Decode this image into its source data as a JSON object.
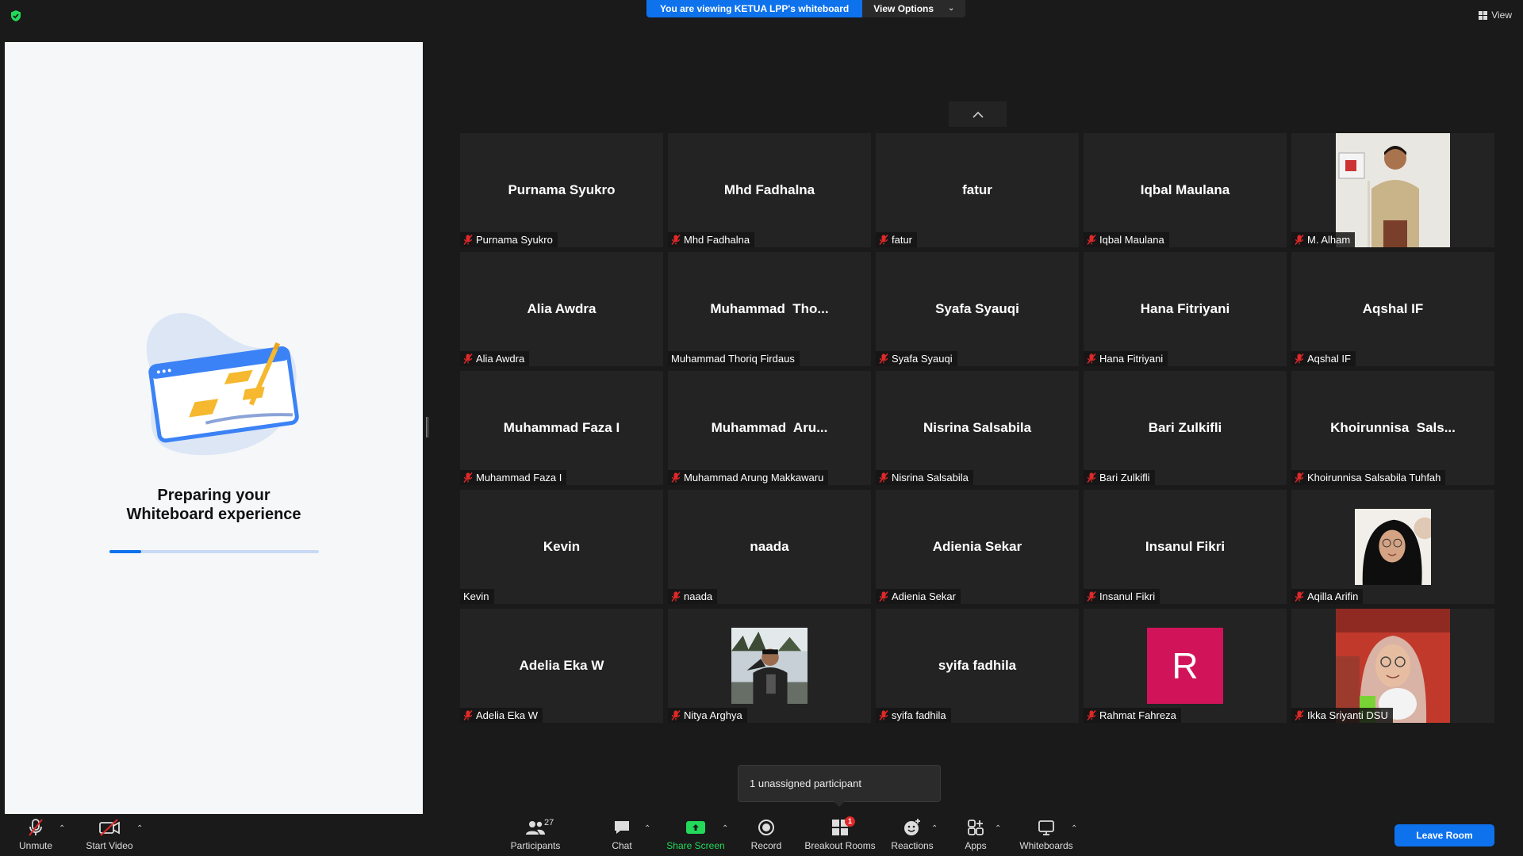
{
  "banner": {
    "viewing": "You are viewing KETUA LPP's whiteboard",
    "view_options": "View Options"
  },
  "view_button": "View",
  "whiteboard": {
    "title_line1": "Preparing your",
    "title_line2": "Whiteboard experience",
    "progress": 0.15
  },
  "participants": [
    {
      "big": "Purnama Syukro",
      "label": "Purnama Syukro",
      "muted": true,
      "type": "name"
    },
    {
      "big": "Mhd Fadhalna",
      "label": "Mhd Fadhalna",
      "muted": true,
      "type": "name"
    },
    {
      "big": "fatur",
      "label": "fatur",
      "muted": true,
      "type": "name"
    },
    {
      "big": "Iqbal Maulana",
      "label": "Iqbal Maulana",
      "muted": true,
      "type": "name"
    },
    {
      "big": "",
      "label": "M. Alham",
      "muted": true,
      "type": "photo-man"
    },
    {
      "big": "Alia Awdra",
      "label": "Alia Awdra",
      "muted": true,
      "type": "name"
    },
    {
      "big": "Muhammad  Tho...",
      "label": "Muhammad Thoriq Firdaus",
      "muted": false,
      "type": "name"
    },
    {
      "big": "Syafa Syauqi",
      "label": "Syafa Syauqi",
      "muted": true,
      "type": "name"
    },
    {
      "big": "Hana Fitriyani",
      "label": "Hana Fitriyani",
      "muted": true,
      "type": "name"
    },
    {
      "big": "Aqshal IF",
      "label": "Aqshal IF",
      "muted": true,
      "type": "name"
    },
    {
      "big": "Muhammad Faza I",
      "label": "Muhammad Faza I",
      "muted": true,
      "type": "name"
    },
    {
      "big": "Muhammad  Aru...",
      "label": "Muhammad Arung Makkawaru",
      "muted": true,
      "type": "name"
    },
    {
      "big": "Nisrina Salsabila",
      "label": "Nisrina Salsabila",
      "muted": true,
      "type": "name"
    },
    {
      "big": "Bari Zulkifli",
      "label": "Bari Zulkifli",
      "muted": true,
      "type": "name"
    },
    {
      "big": "Khoirunnisa  Sals...",
      "label": "Khoirunnisa Salsabila Tuhfah",
      "muted": true,
      "type": "name"
    },
    {
      "big": "Kevin",
      "label": "Kevin",
      "muted": false,
      "type": "name"
    },
    {
      "big": "naada",
      "label": "naada",
      "muted": true,
      "type": "name"
    },
    {
      "big": "Adienia Sekar",
      "label": "Adienia Sekar",
      "muted": true,
      "type": "name"
    },
    {
      "big": "Insanul Fikri",
      "label": "Insanul Fikri",
      "muted": true,
      "type": "name"
    },
    {
      "big": "",
      "label": "Aqilla Arifin",
      "muted": true,
      "type": "photo-hijab"
    },
    {
      "big": "Adelia Eka W",
      "label": "Adelia Eka W",
      "muted": true,
      "type": "name"
    },
    {
      "big": "",
      "label": "Nitya Arghya",
      "muted": true,
      "type": "photo-outdoor"
    },
    {
      "big": "syifa fadhila",
      "label": "syifa fadhila",
      "muted": true,
      "type": "name"
    },
    {
      "big": "R",
      "label": "Rahmat Fahreza",
      "muted": true,
      "type": "initial"
    },
    {
      "big": "",
      "label": "Ikka Sriyanti DSU",
      "muted": true,
      "type": "photo-helmet"
    }
  ],
  "tooltip": "1 unassigned participant",
  "toolbar": {
    "unmute": "Unmute",
    "start_video": "Start Video",
    "participants": "Participants",
    "participants_count": "27",
    "chat": "Chat",
    "share_screen": "Share Screen",
    "record": "Record",
    "breakout_rooms": "Breakout Rooms",
    "breakout_badge": "1",
    "reactions": "Reactions",
    "apps": "Apps",
    "whiteboards": "Whiteboards",
    "leave": "Leave Room"
  },
  "colors": {
    "accent": "#0e72ed",
    "green": "#23d959",
    "muted_red": "#e02828",
    "initial_avatar": "#d1145a"
  }
}
